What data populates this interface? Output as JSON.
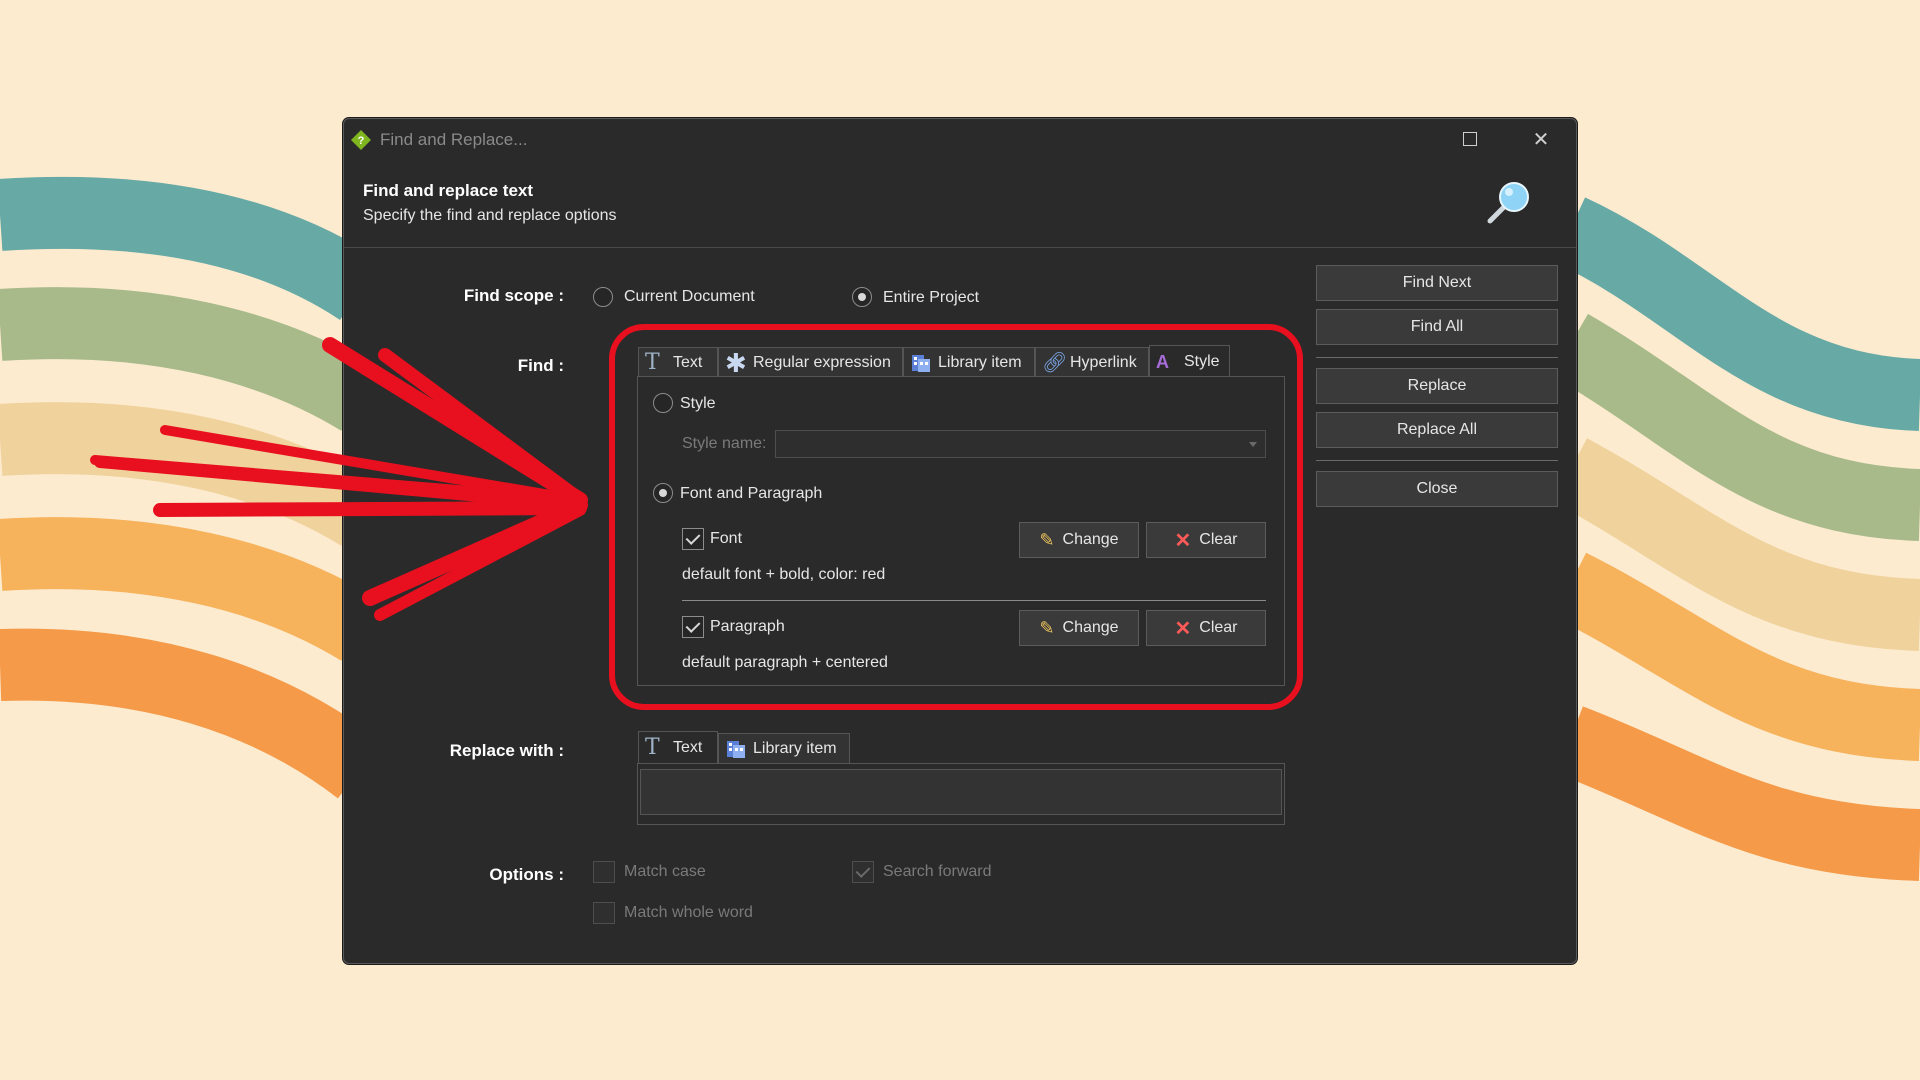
{
  "window": {
    "title": "Find and Replace...",
    "header_title": "Find and replace text",
    "header_subtitle": "Specify the find and replace options"
  },
  "scope": {
    "label": "Find scope :",
    "options": [
      "Current Document",
      "Entire Project"
    ],
    "selected": "Entire Project"
  },
  "find": {
    "label": "Find :",
    "tabs": [
      "Text",
      "Regular expression",
      "Library item",
      "Hyperlink",
      "Style"
    ],
    "active_tab": "Style",
    "style_radio_label": "Style",
    "style_name_label": "Style name:",
    "style_name_value": "",
    "font_paragraph_label": "Font and Paragraph",
    "font_label": "Font",
    "font_checked": true,
    "font_desc": "default font + bold, color: red",
    "paragraph_label": "Paragraph",
    "paragraph_checked": true,
    "paragraph_desc": "default paragraph + centered",
    "change_label": "Change",
    "clear_label": "Clear"
  },
  "replace": {
    "label": "Replace with :",
    "tabs": [
      "Text",
      "Library item"
    ],
    "active_tab": "Text",
    "value": ""
  },
  "options": {
    "label": "Options :",
    "match_case": "Match case",
    "match_case_checked": false,
    "search_forward": "Search forward",
    "search_forward_checked": true,
    "match_whole_word": "Match whole word",
    "match_whole_word_checked": false
  },
  "buttons": {
    "find_next": "Find Next",
    "find_all": "Find All",
    "replace": "Replace",
    "replace_all": "Replace All",
    "close": "Close"
  },
  "colors": {
    "accent_annotation": "#e8101e",
    "wave_teal": "#66a9a5",
    "wave_green": "#a8ba8a",
    "wave_tan": "#f0d29c",
    "wave_orange": "#f7b25c",
    "wave_deep_orange": "#f59a48",
    "background": "#fdebd0"
  }
}
